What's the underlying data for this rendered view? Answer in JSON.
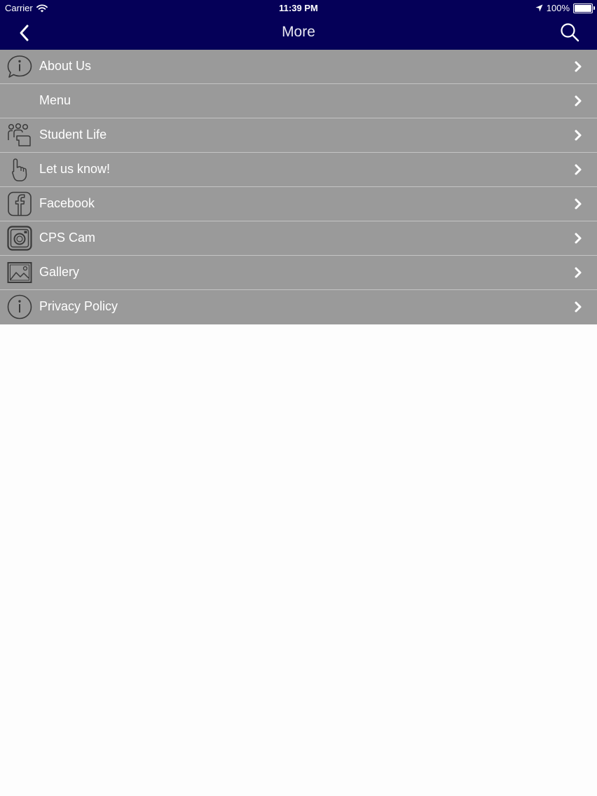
{
  "status_bar": {
    "carrier": "Carrier",
    "time": "11:39 PM",
    "battery": "100%",
    "battery_level": 1.0
  },
  "nav": {
    "title": "More",
    "back_icon": "chevron-left-icon",
    "search_icon": "search-icon"
  },
  "colors": {
    "nav_background": "#050058",
    "row_background": "#9a9a9a",
    "row_divider": "#c4c4c4",
    "page_background": "#fdfdfd"
  },
  "menu": {
    "items": [
      {
        "label": "About Us",
        "icon": "info-speech-bubble-icon"
      },
      {
        "label": "Menu",
        "icon": ""
      },
      {
        "label": "Student Life",
        "icon": "people-group-icon"
      },
      {
        "label": "Let us know!",
        "icon": "pointing-hand-icon"
      },
      {
        "label": "Facebook",
        "icon": "facebook-icon"
      },
      {
        "label": "CPS Cam",
        "icon": "instagram-icon"
      },
      {
        "label": "Gallery",
        "icon": "image-gallery-icon"
      },
      {
        "label": "Privacy Policy",
        "icon": "info-circle-icon"
      }
    ]
  }
}
